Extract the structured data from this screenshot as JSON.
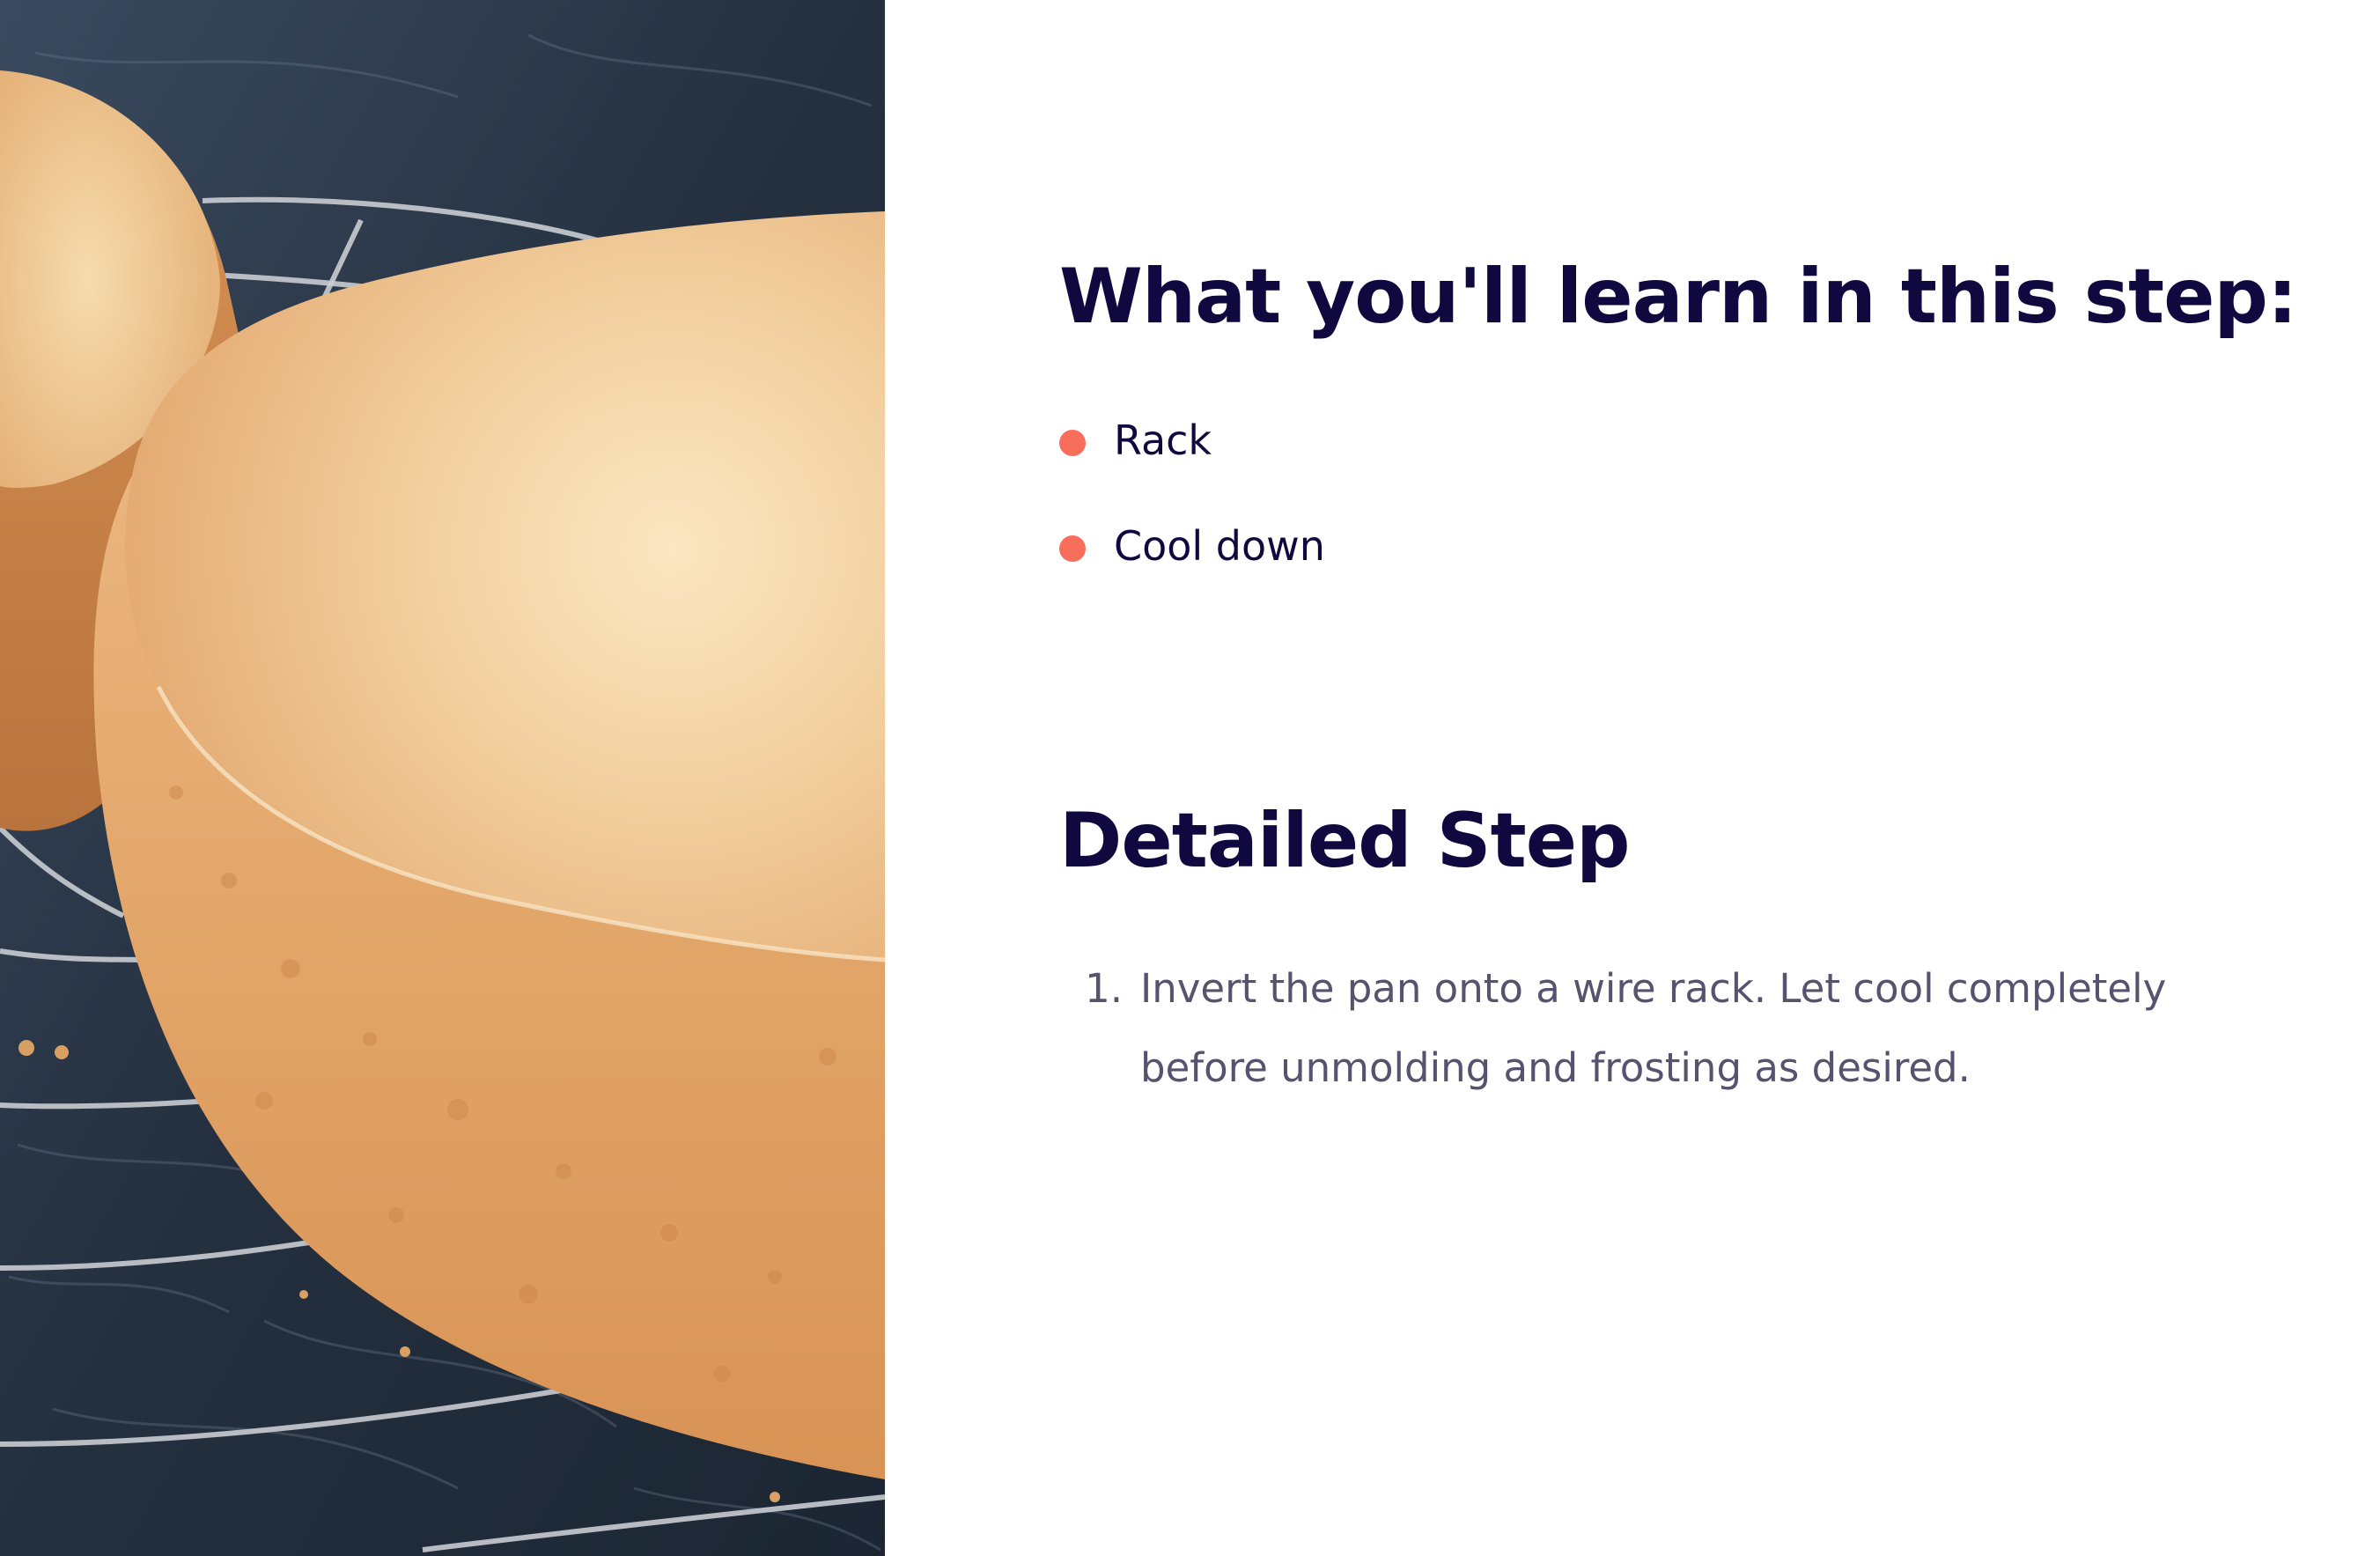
{
  "photo": {
    "description_icon": "cake-photo"
  },
  "learn": {
    "heading": "What you'll learn in this step:",
    "items": [
      {
        "label": "Rack"
      },
      {
        "label": "Cool down"
      }
    ]
  },
  "detail": {
    "heading": "Detailed Step",
    "steps": [
      {
        "number": "1.",
        "text": "Invert the pan onto a wire rack. Let cool completely before unmolding and frosting as desired."
      }
    ]
  },
  "colors": {
    "heading": "#10093f",
    "bullet": "#f96d5b",
    "body_text": "#55536e",
    "background": "#ffffff",
    "countertop": "#2b3848",
    "cake": "#e8b47c"
  }
}
